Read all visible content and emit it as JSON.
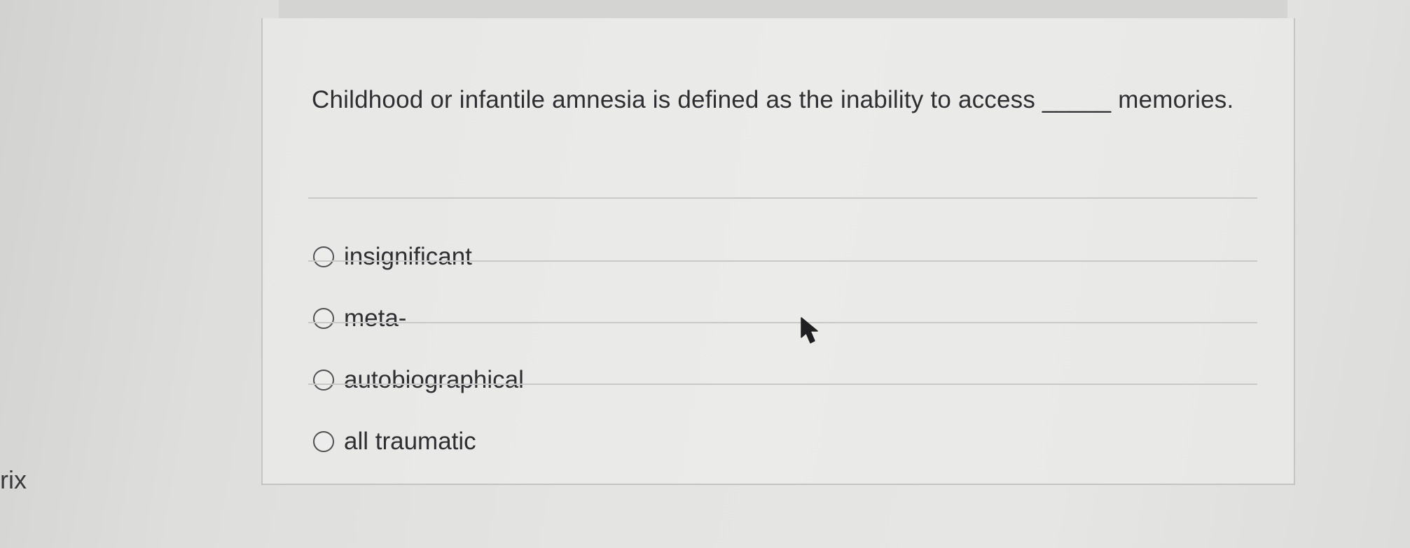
{
  "question": {
    "text": "Childhood or infantile amnesia is defined as the inability to access _____ memories."
  },
  "options": [
    {
      "label": "insignificant",
      "selected": false
    },
    {
      "label": "meta-",
      "selected": false
    },
    {
      "label": "autobiographical",
      "selected": false
    },
    {
      "label": "all traumatic",
      "selected": false
    }
  ],
  "side_panel": {
    "partial_text": "rix"
  },
  "colors": {
    "text": "#2f2f33",
    "card_background": "#e9e9e7",
    "border": "#c4c4c2"
  },
  "icons": {
    "cursor": "mouse-pointer-icon",
    "radio": "radio-button-unchecked"
  }
}
